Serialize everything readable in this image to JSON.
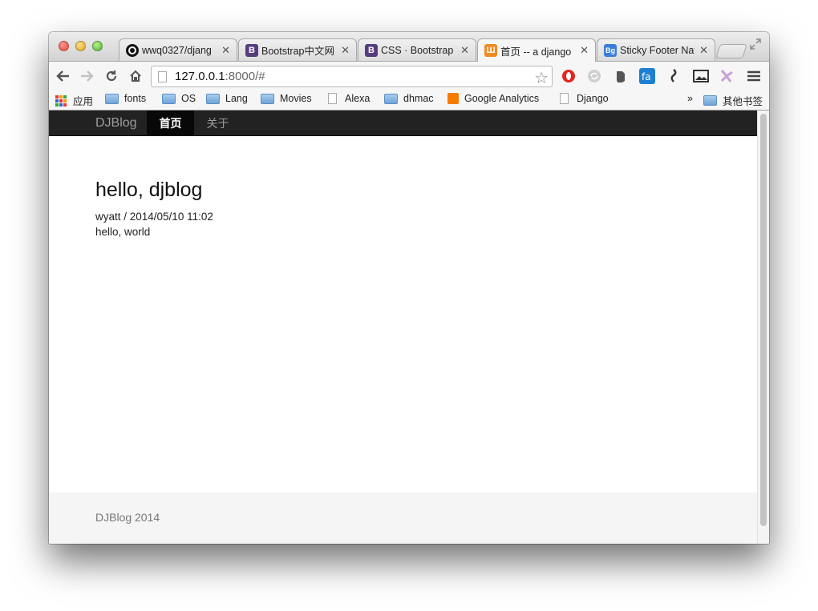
{
  "browser": {
    "tabs": [
      {
        "title": "wwq0327/djang",
        "icon": "github-icon",
        "color": "#111111",
        "glyph": "●"
      },
      {
        "title": "Bootstrap中文网",
        "icon": "bootstrap-icon",
        "color": "#563d7c",
        "glyph": "B"
      },
      {
        "title": "CSS · Bootstrap",
        "icon": "bootstrap-icon",
        "color": "#563d7c",
        "glyph": "B"
      },
      {
        "title": "首页 -- a django",
        "icon": "tumblr-like-icon",
        "color": "#f08a24",
        "glyph": "Ш",
        "active": true
      },
      {
        "title": "Sticky Footer Nav",
        "icon": "bg-icon",
        "color": "#3b7dd8",
        "glyph": "Bg"
      }
    ],
    "close_glyph": "✕",
    "url_host": "127.0.0.1",
    "url_rest": ":8000/#",
    "bookmarks": [
      {
        "label": "应用",
        "icon": "apps-icon"
      },
      {
        "label": "fonts",
        "icon": "folder-icon"
      },
      {
        "label": "OS",
        "icon": "folder-icon"
      },
      {
        "label": "Lang",
        "icon": "folder-icon"
      },
      {
        "label": "Movies",
        "icon": "folder-icon"
      },
      {
        "label": "Alexa",
        "icon": "page-icon"
      },
      {
        "label": "dhmac",
        "icon": "folder-icon"
      },
      {
        "label": "Google Analytics",
        "icon": "analytics-icon"
      },
      {
        "label": "Django",
        "icon": "page-icon"
      }
    ],
    "overflow_label": "»",
    "other_bookmarks": "其他书签"
  },
  "site": {
    "brand": "DJBlog",
    "nav": [
      {
        "label": "首页",
        "active": true
      },
      {
        "label": "关于",
        "active": false
      }
    ],
    "post": {
      "title": "hello, djblog",
      "meta": "wyatt / 2014/05/10 11:02",
      "body": "hello, world"
    },
    "footer": "DJBlog 2014"
  },
  "colors": {
    "navbar_bg": "#222222",
    "navbar_active_bg": "#080808",
    "footer_bg": "#f5f5f5"
  }
}
